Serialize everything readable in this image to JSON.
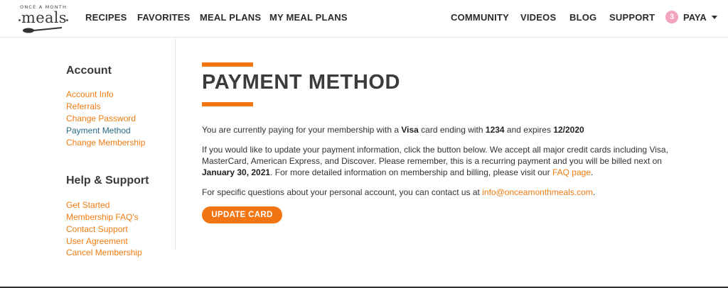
{
  "brand": {
    "tagline": "ONCE A MONTH",
    "name": "meals"
  },
  "nav": {
    "left": [
      "RECIPES",
      "FAVORITES",
      "MEAL PLANS",
      "MY MEAL PLANS"
    ],
    "right": [
      "COMMUNITY",
      "VIDEOS",
      "BLOG",
      "SUPPORT"
    ]
  },
  "user": {
    "notification_count": "3",
    "name": "PAYA",
    "badge_color": "#f2a3bd"
  },
  "sidebar": {
    "account_heading": "Account",
    "account_links": [
      "Account Info",
      "Referrals",
      "Change Password",
      "Payment Method",
      "Change Membership"
    ],
    "active_link": "Payment Method",
    "help_heading": "Help & Support",
    "help_links": [
      "Get Started",
      "Membership FAQ's",
      "Contact Support",
      "User Agreement",
      "Cancel Membership"
    ]
  },
  "main": {
    "title": "PAYMENT METHOD",
    "card_line": {
      "prefix": "You are currently paying for your membership with a ",
      "card_brand": "Visa",
      "middle": " card ending with ",
      "last4": "1234",
      "expires_label": " and expires ",
      "expiry": "12/2020"
    },
    "update_para": {
      "text1": "If you would like to update your payment information, click the button below. We accept all major credit cards including Visa, MasterCard, American Express, and Discover. Please remember, this is a recurring payment and you will be billed next on ",
      "billing_date": "January 30, 2021",
      "text2": ". For more detailed information on membership and billing, please visit our ",
      "faq_link": "FAQ page",
      "text3": "."
    },
    "contact_para": {
      "text": "For specific questions about your personal account, you can contact us at ",
      "email": "info@onceamonthmeals.com",
      "end": "."
    },
    "button_label": "UPDATE CARD"
  },
  "colors": {
    "accent": "#f27412",
    "link": "#f07c12",
    "active_link": "#2a6b86"
  }
}
